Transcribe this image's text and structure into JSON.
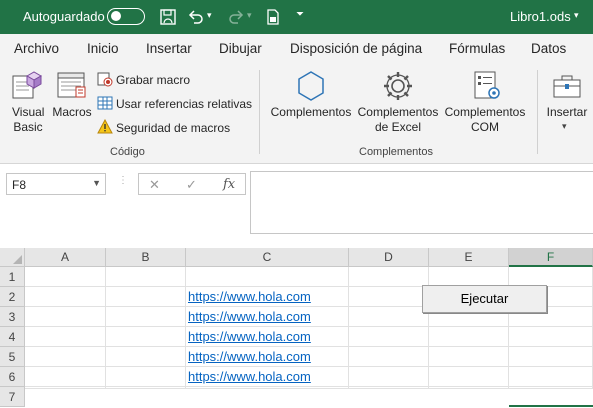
{
  "titlebar": {
    "autosave_label": "Autoguardado",
    "filename": "Libro1.ods"
  },
  "tabs": [
    "Archivo",
    "Inicio",
    "Insertar",
    "Dibujar",
    "Disposición de página",
    "Fórmulas",
    "Datos"
  ],
  "ribbon": {
    "codigo": {
      "visual_basic": "Visual Basic",
      "visual_basic_line1": "Visual",
      "visual_basic_line2": "Basic",
      "macros": "Macros",
      "grabar_macro": "Grabar macro",
      "usar_referencias": "Usar referencias relativas",
      "seguridad_macros": "Seguridad de macros",
      "group_label": "Código"
    },
    "complementos": {
      "complementos": "Complementos",
      "complementos_excel_line1": "Complementos",
      "complementos_excel_line2": "de Excel",
      "complementos_com_line1": "Complementos",
      "complementos_com_line2": "COM",
      "group_label": "Complementos"
    },
    "insertar": {
      "label": "Insertar"
    }
  },
  "formula_bar": {
    "name_box": "F8",
    "fx": "fx",
    "formula": ""
  },
  "grid": {
    "columns": [
      "A",
      "B",
      "C",
      "D",
      "E",
      "F"
    ],
    "selected_column": "F",
    "rows": [
      "1",
      "2",
      "3",
      "4",
      "5",
      "6",
      "7"
    ],
    "links": [
      "https://www.hola.com",
      "https://www.hola.com",
      "https://www.hola.com",
      "https://www.hola.com",
      "https://www.hola.com"
    ],
    "button_label": "Ejecutar"
  },
  "colors": {
    "excel_green": "#217346",
    "link_blue": "#0563c1"
  }
}
